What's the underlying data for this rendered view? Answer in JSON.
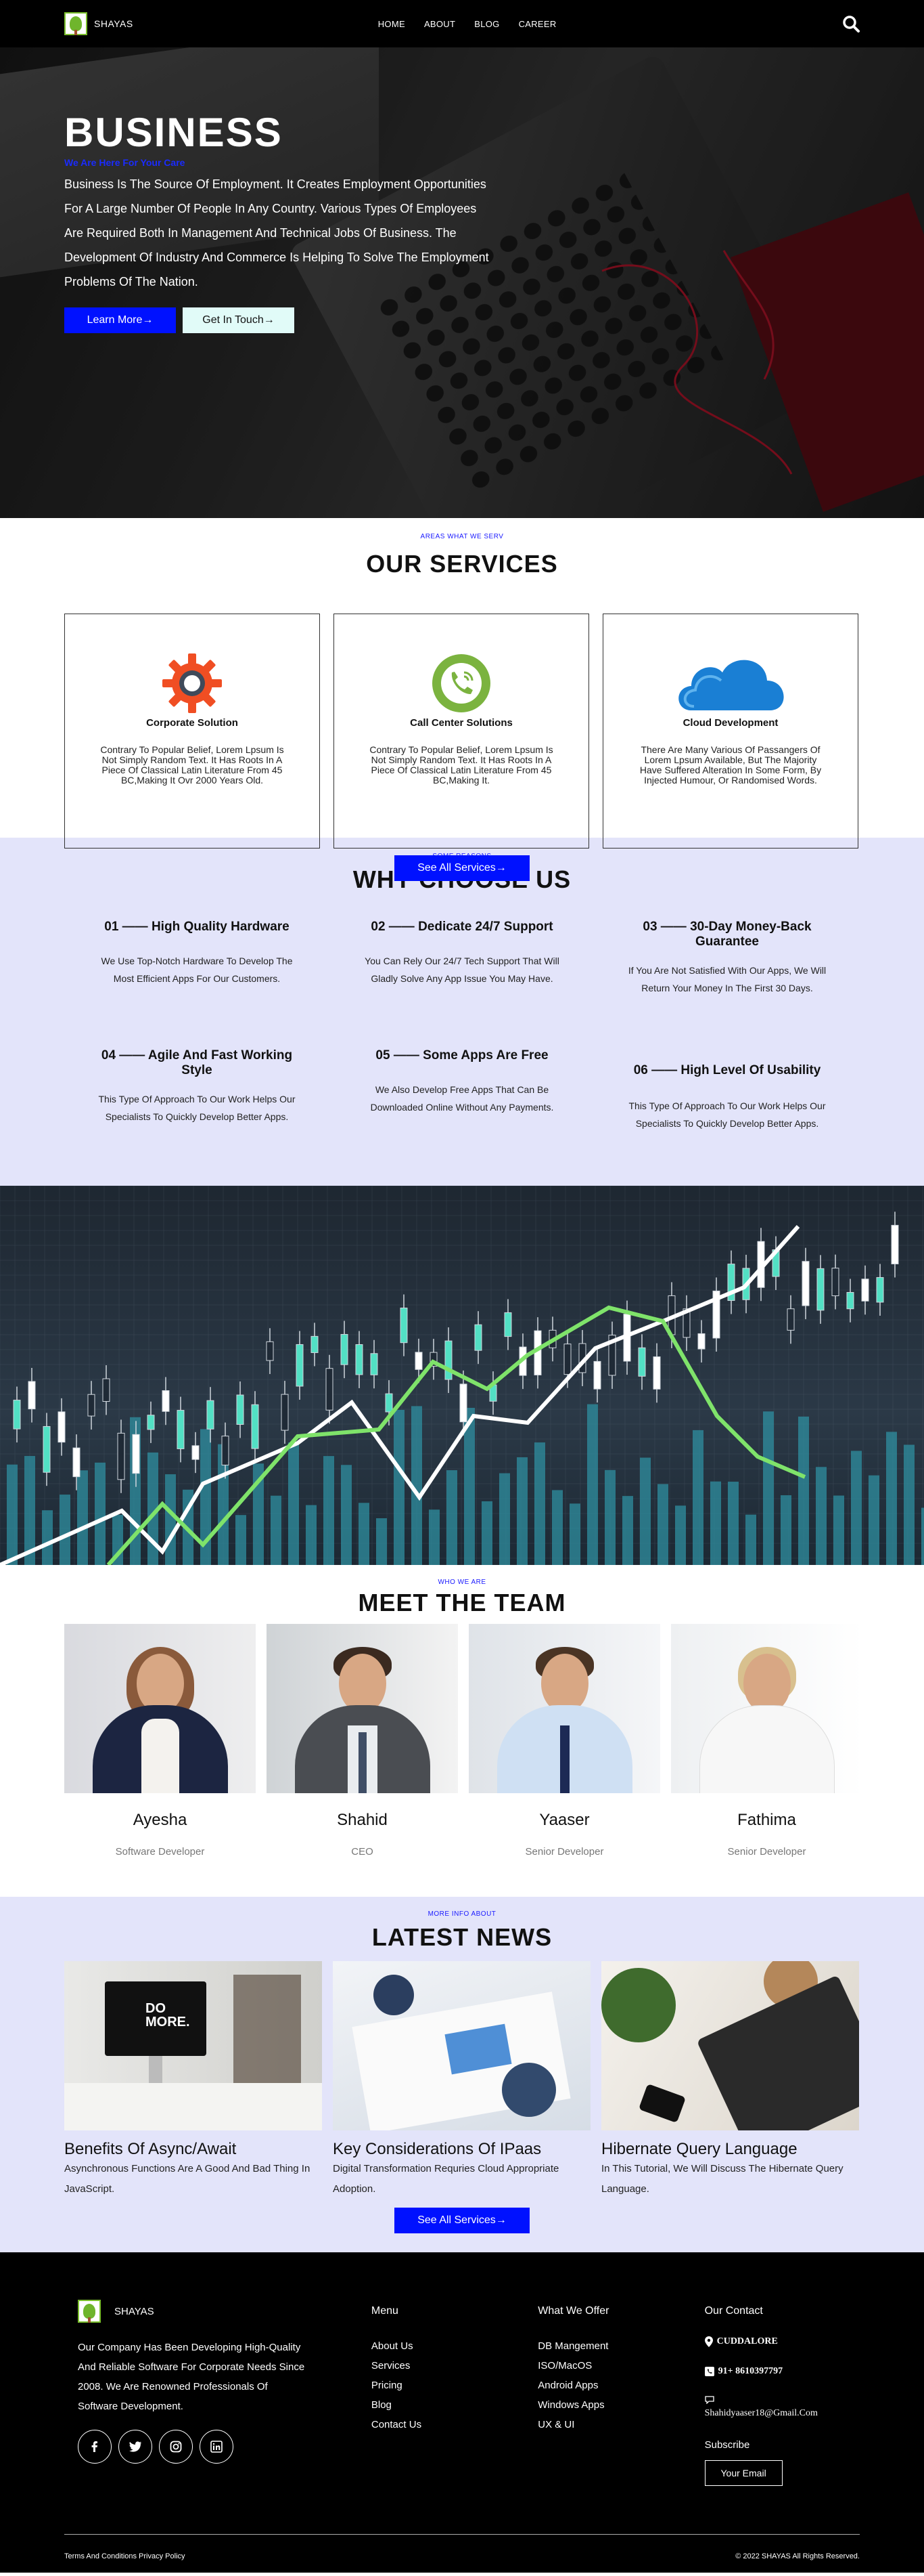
{
  "nav": {
    "brand": "SHAYAS",
    "items": [
      "HOME",
      "ABOUT",
      "BLOG",
      "CAREER"
    ]
  },
  "hero": {
    "title": "BUSINESS",
    "subtitle": "We Are Here For Your Care",
    "text": "Business Is The Source Of Employment. It Creates Employment Opportunities For A Large Number Of People In Any Country. Various Types Of Employees Are Required Both In Management And Technical Jobs Of Business. The Development Of Industry And Commerce Is Helping To Solve The Employment Problems Of The Nation.",
    "btn_primary": "Learn More→",
    "btn_secondary": "Get In Touch→"
  },
  "services": {
    "kicker": "AREAS WHAT WE SERV",
    "heading": "OUR SERVICES",
    "cards": [
      {
        "title": "Corporate Solution",
        "text": "Contrary To Popular Belief, Lorem Lpsum Is Not Simply Random Text. It Has Roots In A Piece Of Classical Latin Literature From 45 BC,Making It Ovr 2000 Years Old.",
        "icon": "gear-icon"
      },
      {
        "title": "Call Center Solutions",
        "text": "Contrary To Popular Belief, Lorem Lpsum Is Not Simply Random Text. It Has Roots In A Piece Of Classical Latin Literature From 45 BC,Making It.",
        "icon": "phone-icon"
      },
      {
        "title": "Cloud Development",
        "text": "There Are Many Various Of Passangers Of Lorem Lpsum Available, But The Majority Have Suffered Alteration In Some Form, By Injected Humour, Or Randomised Words.",
        "icon": "cloud-icon"
      }
    ],
    "button": "See All Services→"
  },
  "why": {
    "kicker": "SOME REASONS",
    "heading": "WHY CHOOSE US",
    "items": [
      {
        "title": "01 —— High Quality Hardware",
        "text": "We Use Top-Notch Hardware To Develop The Most Efficient Apps For Our Customers."
      },
      {
        "title": "02 —— Dedicate 24/7 Support",
        "text": "You Can Rely Our 24/7 Tech Support That Will Gladly Solve Any App Issue You May Have."
      },
      {
        "title": "03 —— 30-Day Money-Back Guarantee",
        "text": "If You Are Not Satisfied With Our Apps, We Will Return Your Money In The First 30 Days."
      },
      {
        "title": "04 —— Agile And Fast Working Style",
        "text": "This Type Of Approach To Our Work Helps Our Specialists To Quickly Develop Better Apps."
      },
      {
        "title": "05 —— Some Apps Are Free",
        "text": "We Also Develop Free Apps That Can Be Downloaded Online Without Any Payments."
      },
      {
        "title": "06 —— High Level Of Usability",
        "text": "This Type Of Approach To Our Work Helps Our Specialists To Quickly Develop Better Apps."
      }
    ]
  },
  "team": {
    "kicker": "WHO WE ARE",
    "heading": "MEET THE TEAM",
    "members": [
      {
        "name": "Ayesha",
        "role": "Software Developer"
      },
      {
        "name": "Shahid",
        "role": "CEO"
      },
      {
        "name": "Yaaser",
        "role": "Senior Developer"
      },
      {
        "name": "Fathima",
        "role": "Senior Developer"
      }
    ]
  },
  "news": {
    "kicker": "MORE INFO ABOUT",
    "heading": "LATEST NEWS",
    "posts": [
      {
        "title": "Benefits Of Async/Await",
        "text": "Asynchronous Functions Are A Good And Bad Thing In JavaScript."
      },
      {
        "title": "Key Considerations Of IPaas",
        "text": "Digital Transformation Requries Cloud Appropriate Adoption."
      },
      {
        "title": "Hibernate Query Language",
        "text": "In This Tutorial, We Will Discuss The Hibernate Query Language."
      }
    ],
    "button": "See All Services→",
    "monitor_text": "DO MORE."
  },
  "footer": {
    "brand": "SHAYAS",
    "about": "Our Company Has Been Developing High-Quality And Reliable Software For Corporate Needs Since 2008. We Are Renowned Professionals Of Software Development.",
    "menu_heading": "Menu",
    "menu": [
      "About Us",
      "Services",
      "Pricing",
      "Blog",
      "Contact Us"
    ],
    "offer_heading": "What We Offer",
    "offer": [
      "DB Mangement",
      "ISO/MacOS",
      "Android Apps",
      "Windows Apps",
      "UX & UI"
    ],
    "contact_heading": "Our Contact",
    "location": "CUDDALORE",
    "phone": "91+ 8610397797",
    "email": "Shahidyaaser18@Gmail.Com",
    "subscribe": "Subscribe",
    "email_button": "Your Email",
    "bottom_left": "Terms And Conditions Privacy Policy",
    "bottom_right": "© 2022 SHAYAS All Rights Reserved."
  }
}
